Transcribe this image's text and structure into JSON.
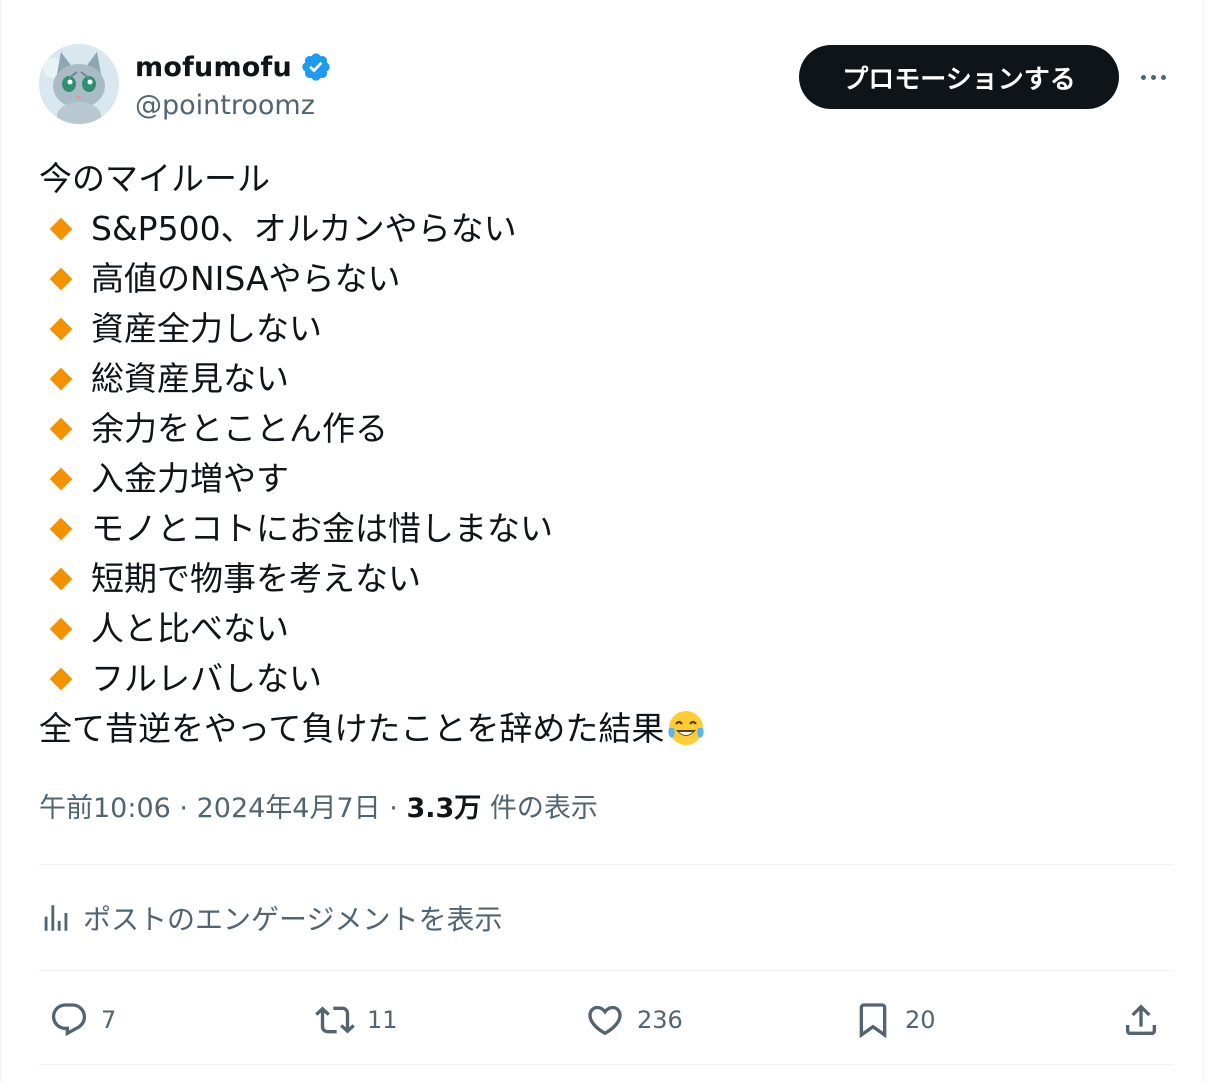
{
  "user": {
    "display_name": "mofumofu",
    "handle": "@pointroomz",
    "verified": true,
    "verified_color": "#1d9bf0"
  },
  "header": {
    "promote_label": "プロモーションする"
  },
  "tweet": {
    "title_line": "今のマイルール",
    "bullet_color": "#f39200",
    "rules": [
      "S&P500、オルカンやらない",
      "高値のNISAやらない",
      "資産全力しない",
      "総資産見ない",
      "余力をとことん作る",
      "入金力増やす",
      "モノとコトにお金は惜しまない",
      "短期で物事を考えない",
      "人と比べない",
      "フルレバしない"
    ],
    "closing_line": "全て昔逆をやって負けたことを辞めた結果",
    "closing_emoji": "face-with-tears-of-joy"
  },
  "meta": {
    "time": "午前10:06",
    "sep1": "·",
    "date": "2024年4月7日",
    "sep2": "·",
    "views": "3.3万",
    "views_suffix": "件の表示"
  },
  "engagement": {
    "label": "ポストのエンゲージメントを表示"
  },
  "actions": {
    "replies": "7",
    "reposts": "11",
    "likes": "236",
    "bookmarks": "20"
  },
  "colors": {
    "text": "#0f1419",
    "secondary": "#536471",
    "divider": "#eff3f4"
  }
}
